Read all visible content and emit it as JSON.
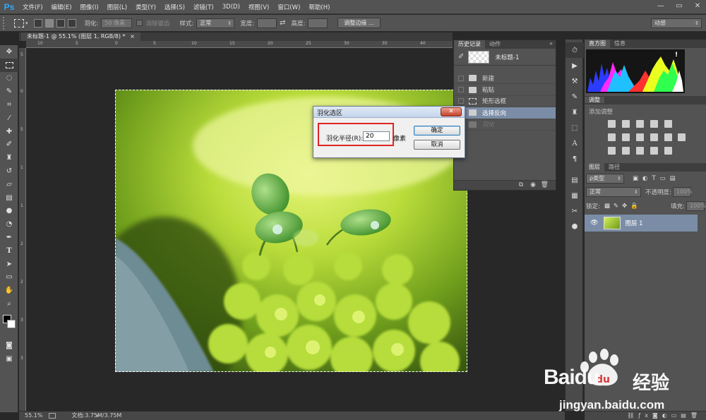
{
  "app": {
    "logo": "Ps"
  },
  "menu": [
    "文件(F)",
    "编辑(E)",
    "图像(I)",
    "图层(L)",
    "类型(Y)",
    "选择(S)",
    "滤镜(T)",
    "3D(D)",
    "视图(V)",
    "窗口(W)",
    "帮助(H)"
  ],
  "window_controls": {
    "minimize": "—",
    "restore": "▭",
    "close": "✕"
  },
  "options_bar": {
    "feather_label": "羽化:",
    "feather_value": "50 像素",
    "antialias_label": "消除锯齿",
    "style_label": "样式:",
    "style_value": "正常",
    "width_label": "宽度:",
    "height_label": "高度:",
    "refine_edge_button": "调整边缘 ...",
    "workspace_value": "动感"
  },
  "document": {
    "tab_title": "未标题-1 @ 55.1% (图层 1, RGB/8) *",
    "tab_close": "×"
  },
  "rulers": {
    "top": [
      "10",
      "5",
      "0",
      "5",
      "10",
      "15",
      "20",
      "25",
      "30",
      "35",
      "40"
    ],
    "left": [
      "5",
      "0",
      "5",
      "1",
      "1",
      "2",
      "2",
      "3",
      "3"
    ]
  },
  "status": {
    "zoom": "55.1%",
    "doc_info": "文档:3.75M/3.75M"
  },
  "history_panel": {
    "tabs": [
      "历史记录",
      "动作"
    ],
    "snapshot_label": "未标题-1",
    "items": [
      {
        "label": "新建",
        "state": "normal"
      },
      {
        "label": "粘贴",
        "state": "normal"
      },
      {
        "label": "矩形选框",
        "state": "normal"
      },
      {
        "label": "选择反向",
        "state": "selected"
      },
      {
        "label": "羽化",
        "state": "dimmed"
      }
    ]
  },
  "histogram_panel": {
    "tabs": [
      "直方图",
      "信息"
    ],
    "warning": "!"
  },
  "adjustments_panel": {
    "tab": "调整",
    "title": "添加调整"
  },
  "layers_panel": {
    "tabs": [
      "图层",
      "路径"
    ],
    "filter_kind": "ρ类型",
    "blend_mode": "正常",
    "opacity_label": "不透明度:",
    "opacity_value": "100%",
    "lock_label": "锁定:",
    "fill_label": "填充:",
    "fill_value": "100%",
    "layers": [
      {
        "name": "图层 1",
        "visible": true
      }
    ]
  },
  "dialog": {
    "title": "羽化选区",
    "close": "✕",
    "radius_label": "羽化半径(R):",
    "radius_value": "20",
    "unit": "像素",
    "ok": "确定",
    "cancel": "取消"
  },
  "watermark": {
    "brand": "Baidu",
    "brand_cn": "经验",
    "url": "jingyan.baidu.com"
  },
  "colors": {
    "ui_dark": "#282828",
    "panel": "#535353",
    "selection": "#7b8da6",
    "alert_red": "#e02424",
    "ps_blue": "#31a8ff"
  }
}
